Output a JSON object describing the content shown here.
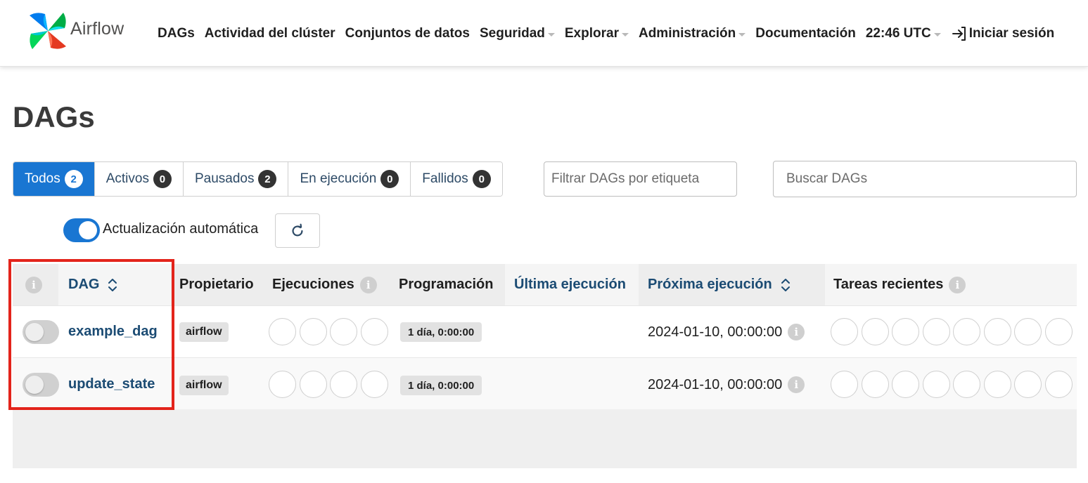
{
  "navbar": {
    "brand": "Airflow",
    "items": [
      {
        "label": "DAGs",
        "dropdown": false
      },
      {
        "label": "Actividad del clúster",
        "dropdown": false
      },
      {
        "label": "Conjuntos de datos",
        "dropdown": false
      },
      {
        "label": "Seguridad",
        "dropdown": true
      },
      {
        "label": "Explorar",
        "dropdown": true
      },
      {
        "label": "Administración",
        "dropdown": true
      },
      {
        "label": "Documentación",
        "dropdown": false
      }
    ],
    "time": "22:46 UTC",
    "login": "Iniciar sesión"
  },
  "page": {
    "title": "DAGs"
  },
  "status_tabs": [
    {
      "label": "Todos",
      "count": "2",
      "active": true
    },
    {
      "label": "Activos",
      "count": "0",
      "active": false
    },
    {
      "label": "Pausados",
      "count": "2",
      "active": false
    },
    {
      "label": "En ejecución",
      "count": "0",
      "active": false
    },
    {
      "label": "Fallidos",
      "count": "0",
      "active": false
    }
  ],
  "filters": {
    "tag_placeholder": "Filtrar DAGs por etiqueta",
    "search_placeholder": "Buscar DAGs"
  },
  "auto_refresh": {
    "label": "Actualización automática",
    "enabled": true
  },
  "table": {
    "columns": {
      "dag": "DAG",
      "owner": "Propietario",
      "runs": "Ejecuciones",
      "schedule": "Programación",
      "last_run": "Última ejecución",
      "next_run": "Próxima ejecución",
      "recent_tasks": "Tareas recientes"
    },
    "rows": [
      {
        "dag_id": "example_dag",
        "owner": "airflow",
        "schedule": "1 día, 0:00:00",
        "next_run": "2024-01-10, 00:00:00",
        "paused": true
      },
      {
        "dag_id": "update_state",
        "owner": "airflow",
        "schedule": "1 día, 0:00:00",
        "next_run": "2024-01-10, 00:00:00",
        "paused": true
      }
    ]
  },
  "icons": {
    "info": "i",
    "login": "login-arrow-icon",
    "refresh": "refresh-icon",
    "sort": "sort-icon"
  },
  "colors": {
    "primary": "#1976d2",
    "link": "#1b4b73",
    "highlight": "#e3241b"
  }
}
